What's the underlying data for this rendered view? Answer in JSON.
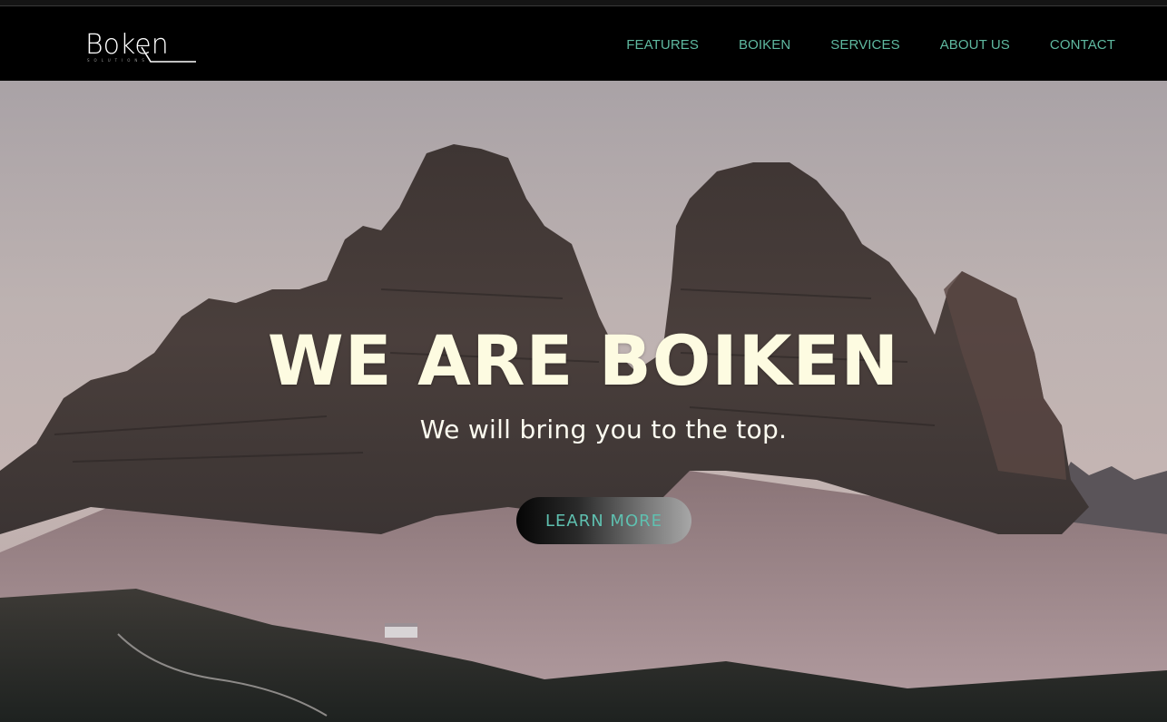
{
  "brand": {
    "name": "Boken",
    "tagline": "SOLUTIONS"
  },
  "nav": {
    "items": [
      "FEATURES",
      "BOIKEN",
      "SERVICES",
      "ABOUT US",
      "CONTACT"
    ]
  },
  "hero": {
    "title": "WE ARE BOIKEN",
    "subtitle": "We will bring you to the top.",
    "cta_label": "LEARN MORE"
  },
  "colors": {
    "accent": "#5fb9a0",
    "title": "#fdfbe1",
    "header_bg": "#000000"
  }
}
